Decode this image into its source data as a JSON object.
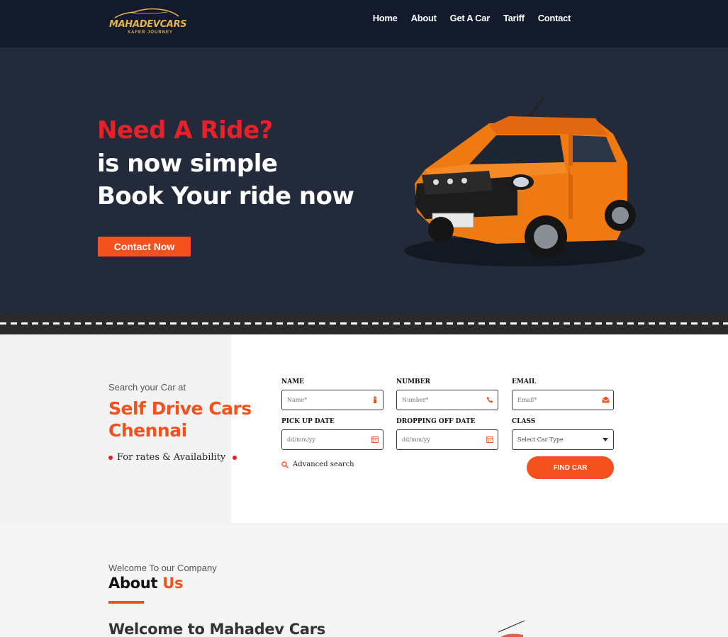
{
  "nav": {
    "logo_text": "MAHADEVCARS",
    "logo_tagline": "SAFER JOURNEY",
    "items": [
      "Home",
      "About",
      "Get A Car",
      "Tariff",
      "Contact"
    ]
  },
  "hero": {
    "line1": "Need A Ride?",
    "line2": "is now simple",
    "line3": "Book Your ride now",
    "cta": "Contact Now"
  },
  "search": {
    "pre_title": "Search your Car at",
    "title": "Self Drive Cars Chennai",
    "availability": "For rates & Availability",
    "fields": {
      "name": {
        "label": "NAME",
        "placeholder": "Name*"
      },
      "number": {
        "label": "NUMBER",
        "placeholder": "Number*"
      },
      "email": {
        "label": "EMAIL",
        "placeholder": "Email*"
      },
      "pickup": {
        "label": "PICK UP DATE",
        "placeholder": "dd/mm/yy"
      },
      "dropoff": {
        "label": "DROPPING OFF DATE",
        "placeholder": "dd/mm/yy"
      },
      "class": {
        "label": "CLASS",
        "value": "Select Car Type"
      }
    },
    "advanced": "Advanced search",
    "find_button": "FIND CAR"
  },
  "about": {
    "pre_title": "Welcome To our Company",
    "title_main": "About",
    "title_accent": "Us",
    "heading": "Welcome to Mahadev Cars"
  },
  "colors": {
    "accent": "#f4511e",
    "red": "#e8202a",
    "nav_bg": "#121a2c",
    "hero_bg": "#232b3a",
    "car_orange": "#f07a12"
  },
  "icons": [
    "person-icon",
    "phone-icon",
    "envelope-icon",
    "calendar-icon",
    "search-icon"
  ]
}
